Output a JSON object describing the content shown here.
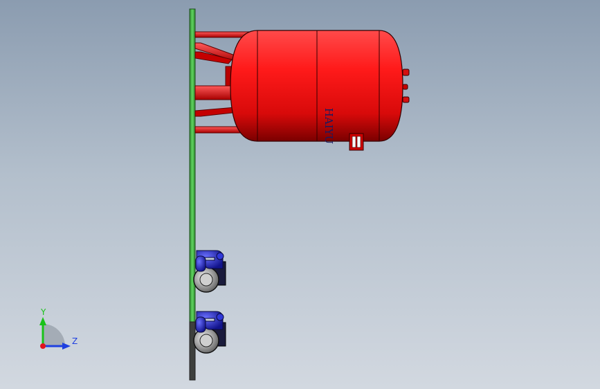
{
  "viewport": {
    "background_top": "#8b9cb0",
    "background_bottom": "#d2d8e0"
  },
  "model": {
    "tank_label": "HAIYU",
    "tank_color": "#e01010",
    "frame_color": "#45b845",
    "pump_color": "#2a2fd0"
  },
  "triad": {
    "y_label": "Y",
    "z_label": "Z",
    "y_color": "#19c219",
    "z_color": "#1e3fe0",
    "x_color": "#e0141e"
  }
}
